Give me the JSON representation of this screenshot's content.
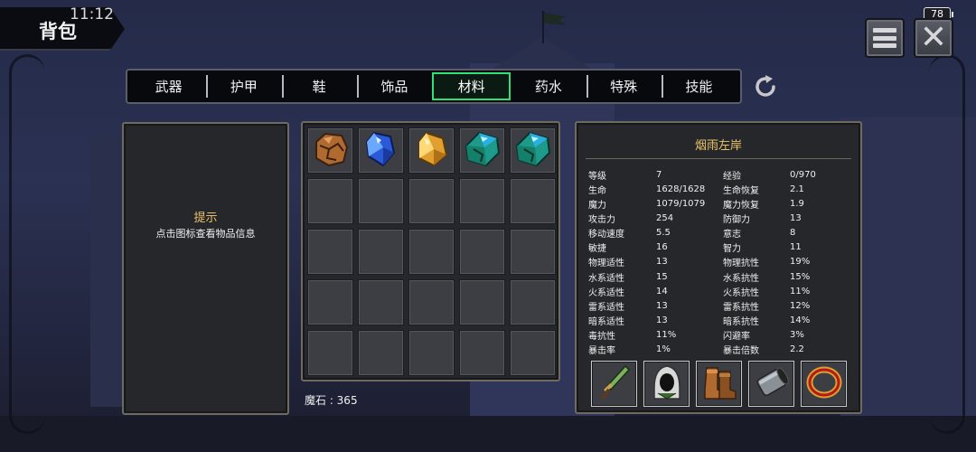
{
  "status_bar": {
    "time": "11:12",
    "battery": "78"
  },
  "header": {
    "title": "背包"
  },
  "tabs": [
    {
      "label": "武器",
      "active": false
    },
    {
      "label": "护甲",
      "active": false
    },
    {
      "label": "鞋",
      "active": false
    },
    {
      "label": "饰品",
      "active": false
    },
    {
      "label": "材料",
      "active": true
    },
    {
      "label": "药水",
      "active": false
    },
    {
      "label": "特殊",
      "active": false
    },
    {
      "label": "技能",
      "active": false
    }
  ],
  "hint_panel": {
    "title": "提示",
    "text": "点击图标查看物品信息"
  },
  "inventory": {
    "items": [
      {
        "icon": "cracked-ore-icon"
      },
      {
        "icon": "blue-crystal-icon"
      },
      {
        "icon": "amber-crystal-icon"
      },
      {
        "icon": "teal-crystal-icon"
      },
      {
        "icon": "teal-crystal-icon"
      }
    ],
    "total_slots": 25,
    "currency_label": "魔石 : 365"
  },
  "character": {
    "name": "烟雨左岸",
    "stats": [
      [
        "等级",
        "7",
        "经验",
        "0/970"
      ],
      [
        "生命",
        "1628/1628",
        "生命恢复",
        "2.1"
      ],
      [
        "魔力",
        "1079/1079",
        "魔力恢复",
        "1.9"
      ],
      [
        "攻击力",
        "254",
        "防御力",
        "13"
      ],
      [
        "移动速度",
        "5.5",
        "意志",
        "8"
      ],
      [
        "敏捷",
        "16",
        "智力",
        "11"
      ],
      [
        "物理适性",
        "13",
        "物理抗性",
        "19%"
      ],
      [
        "水系适性",
        "15",
        "水系抗性",
        "15%"
      ],
      [
        "火系适性",
        "14",
        "火系抗性",
        "11%"
      ],
      [
        "雷系适性",
        "13",
        "雷系抗性",
        "12%"
      ],
      [
        "暗系适性",
        "13",
        "暗系抗性",
        "14%"
      ],
      [
        "毒抗性",
        "11%",
        "闪避率",
        "3%"
      ],
      [
        "暴击率",
        "1%",
        "暴击倍数",
        "2.2"
      ]
    ],
    "equipment": [
      {
        "icon": "dagger-icon"
      },
      {
        "icon": "hood-icon"
      },
      {
        "icon": "boots-icon"
      },
      {
        "icon": "bracer-icon"
      },
      {
        "icon": "ring-icon"
      }
    ]
  },
  "colors": {
    "accent_gold": "#e9c36a",
    "active_tab": "#2fe07a"
  }
}
